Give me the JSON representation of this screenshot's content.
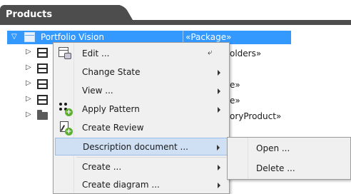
{
  "panel": {
    "title": "Products"
  },
  "tree": {
    "root": {
      "label": "Portfolio Vision",
      "stereotype": "«Package»"
    },
    "bg_fragments": [
      "olders»",
      "e»",
      "e»",
      "oryProduct»"
    ]
  },
  "context_menu": {
    "items": [
      {
        "label": "Edit ...",
        "shortcut": "⤶"
      },
      {
        "label": "Change State"
      },
      {
        "label": "View ..."
      },
      {
        "label": "Apply Pattern"
      },
      {
        "label": "Create Review"
      },
      {
        "label": "Description document ..."
      },
      {
        "label": "Create ..."
      },
      {
        "label": "Create diagram ..."
      }
    ]
  },
  "submenu": {
    "items": [
      {
        "label": "Open ..."
      },
      {
        "label": "Delete ..."
      }
    ]
  },
  "colors": {
    "selection": "#3399ff",
    "tab": "#4d4d4d",
    "menu_highlight": "#cfe0f5",
    "badge_green": "#5cb02e"
  }
}
